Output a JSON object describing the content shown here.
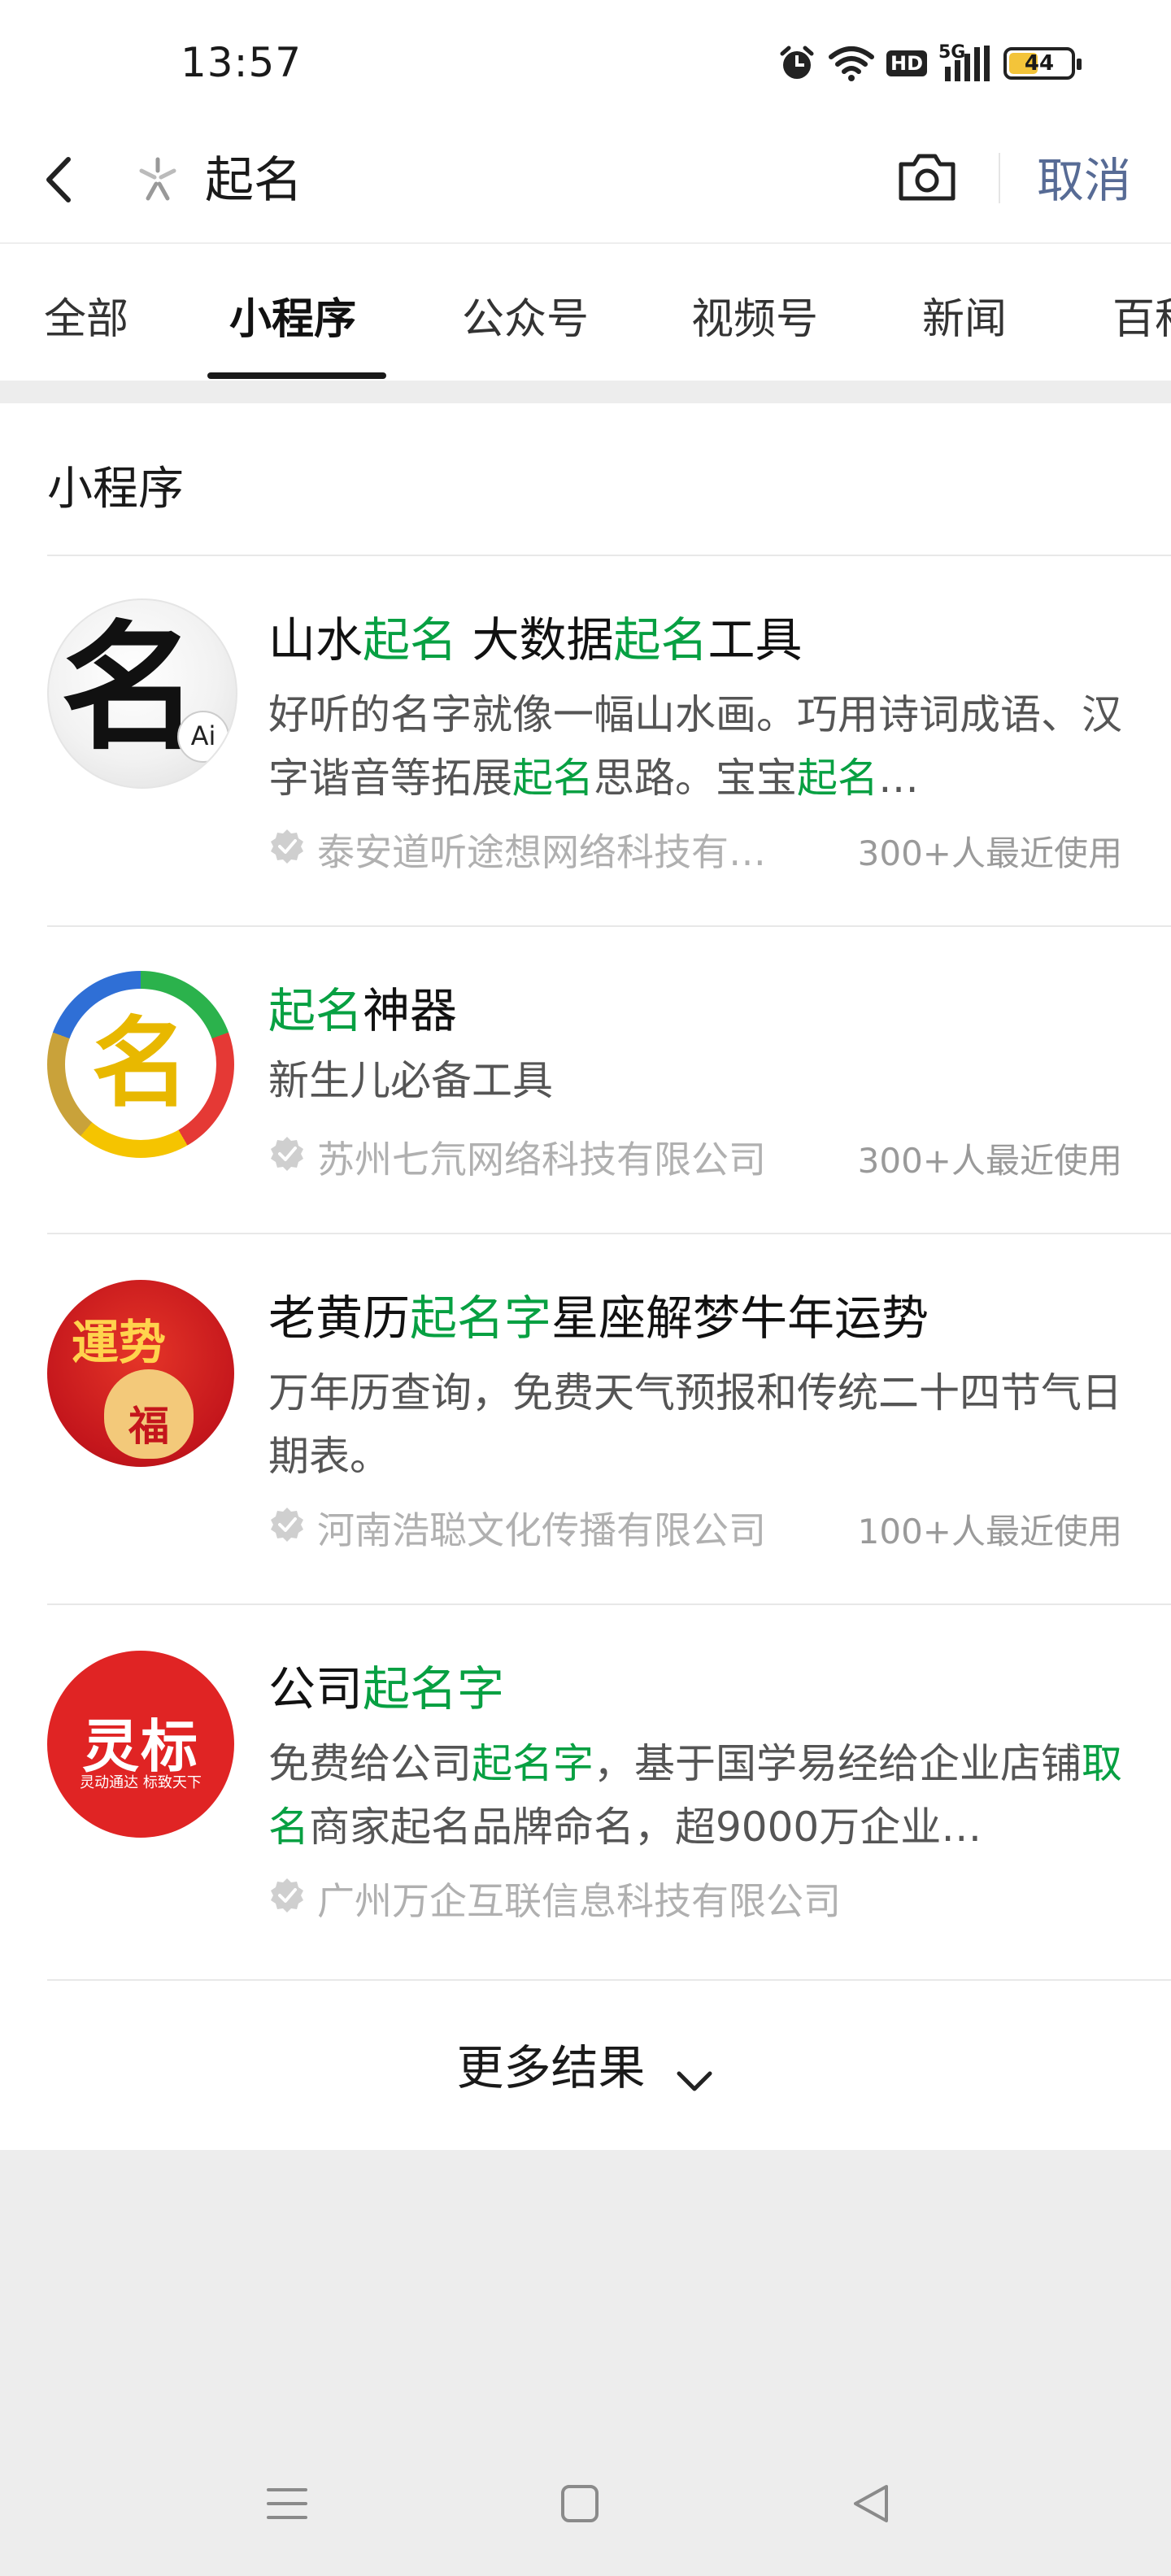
{
  "status_bar": {
    "time": "13:57",
    "network_label": "HD",
    "signal_label": "5G",
    "battery_level": "44"
  },
  "search": {
    "query": "起名",
    "cancel_label": "取消"
  },
  "tabs": [
    {
      "label": "全部",
      "active": false
    },
    {
      "label": "小程序",
      "active": true
    },
    {
      "label": "公众号",
      "active": false
    },
    {
      "label": "视频号",
      "active": false
    },
    {
      "label": "新闻",
      "active": false
    },
    {
      "label": "百科",
      "active": false
    }
  ],
  "section": {
    "title": "小程序"
  },
  "results": [
    {
      "title_parts": [
        {
          "text": "山水",
          "highlight": false
        },
        {
          "text": "起名",
          "highlight": true
        },
        {
          "text": " 大数据",
          "highlight": false
        },
        {
          "text": "起名",
          "highlight": true
        },
        {
          "text": "工具",
          "highlight": false
        }
      ],
      "desc_parts": [
        {
          "text": "好听的名字就像一幅山水画。巧用诗词成语、汉字谐音等拓展",
          "highlight": false
        },
        {
          "text": "起名",
          "highlight": true
        },
        {
          "text": "思路。宝宝",
          "highlight": false
        },
        {
          "text": "起名",
          "highlight": true
        },
        {
          "text": "…",
          "highlight": false
        }
      ],
      "company": "泰安道听途想网络科技有…",
      "usage": "300+人最近使用",
      "avatar_text": "名",
      "avatar_badge": "Ai"
    },
    {
      "title_parts": [
        {
          "text": "起名",
          "highlight": true
        },
        {
          "text": "神器",
          "highlight": false
        }
      ],
      "desc_parts": [
        {
          "text": "新生儿必备工具",
          "highlight": false
        }
      ],
      "company": "苏州七氘网络科技有限公司",
      "usage": "300+人最近使用",
      "avatar_text": "名"
    },
    {
      "title_parts": [
        {
          "text": "老黄历",
          "highlight": false
        },
        {
          "text": "起名字",
          "highlight": true
        },
        {
          "text": "星座解梦牛年运势",
          "highlight": false
        }
      ],
      "desc_parts": [
        {
          "text": "万年历查询，免费天气预报和传统二十四节气日期表。",
          "highlight": false
        }
      ],
      "company": "河南浩聪文化传播有限公司",
      "usage": "100+人最近使用",
      "avatar_text": "運势",
      "avatar_sub": "福"
    },
    {
      "title_parts": [
        {
          "text": "公司",
          "highlight": false
        },
        {
          "text": "起名字",
          "highlight": true
        }
      ],
      "desc_parts": [
        {
          "text": "免费给公司",
          "highlight": false
        },
        {
          "text": "起名字",
          "highlight": true
        },
        {
          "text": "，基于国学易经给企业店铺",
          "highlight": false
        },
        {
          "text": "取名",
          "highlight": true
        },
        {
          "text": "商家起名品牌命名，超9000万企业…",
          "highlight": false
        }
      ],
      "company": "广州万企互联信息科技有限公司",
      "usage": "",
      "avatar_text": "灵标",
      "avatar_sub": "灵动通达 标致天下"
    }
  ],
  "more_results_label": "更多结果",
  "colors": {
    "highlight": "#07a042",
    "link": "#576b95",
    "background": "#ededed"
  },
  "icons": [
    "back-arrow-icon",
    "search-icon",
    "camera-icon",
    "verified-icon",
    "chevron-down-icon",
    "menu-icon",
    "home-icon",
    "back-triangle-icon",
    "alarm-icon",
    "wifi-icon",
    "signal-icon",
    "battery-icon"
  ]
}
